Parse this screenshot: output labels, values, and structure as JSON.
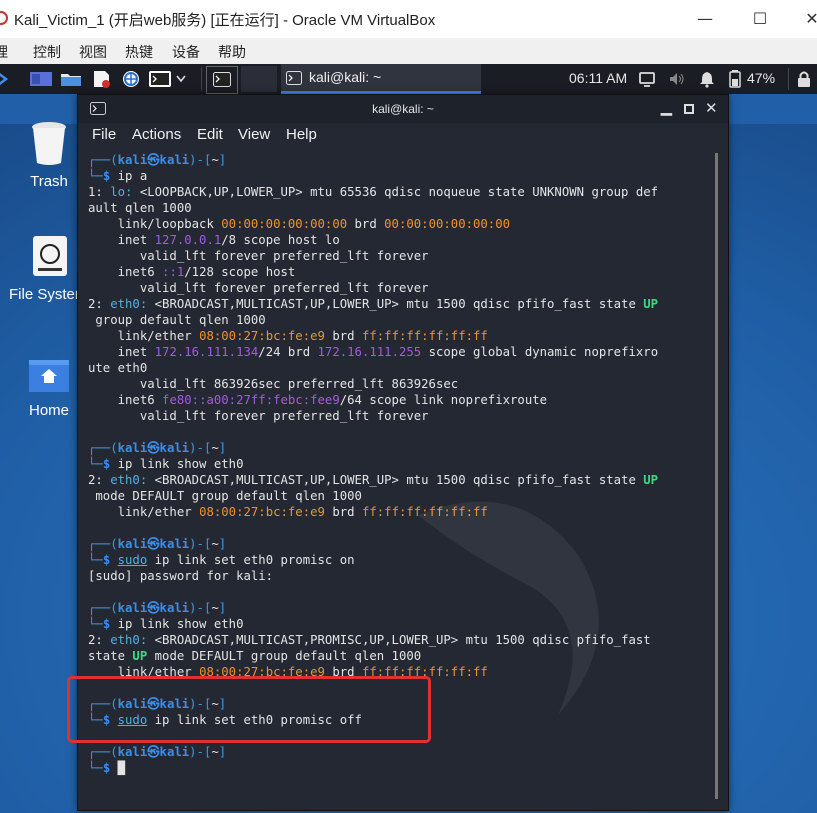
{
  "window": {
    "title": "Kali_Victim_1 (开启web服务) [正在运行] - Oracle VM VirtualBox"
  },
  "vbox_menu": [
    "理",
    "控制",
    "视图",
    "热键",
    "设备",
    "帮助"
  ],
  "panel": {
    "task_label": "kali@kali: ~",
    "time": "06:11 AM",
    "battery": "47%"
  },
  "desktop_icons": [
    {
      "label": "Trash",
      "icon": "trash-icon"
    },
    {
      "label": "File Syster",
      "icon": "drive-icon"
    },
    {
      "label": "Home",
      "icon": "home-folder-icon"
    }
  ],
  "terminal": {
    "title": "kali@kali: ~",
    "menu": [
      "File",
      "Actions",
      "Edit",
      "View",
      "Help"
    ],
    "lines": [
      [
        {
          "t": "┌──(",
          "c": "g"
        },
        {
          "t": "kali㉿kali",
          "c": "b"
        },
        {
          "t": ")-[",
          "c": "g"
        },
        {
          "t": "~",
          "c": "w"
        },
        {
          "t": "]",
          "c": "g"
        }
      ],
      [
        {
          "t": "└─",
          "c": "g"
        },
        {
          "t": "$ ",
          "c": "b"
        },
        {
          "t": "ip a",
          "c": "w"
        }
      ],
      [
        {
          "t": "1: ",
          "c": "w"
        },
        {
          "t": "lo:",
          "c": "u"
        },
        {
          "t": " <LOOPBACK,UP,LOWER_UP> mtu 65536 qdisc noqueue state UNKNOWN group def",
          "c": "w"
        }
      ],
      [
        {
          "t": "ault qlen 1000",
          "c": "w"
        }
      ],
      [
        {
          "t": "    link/loopback ",
          "c": "w"
        },
        {
          "t": "00:00:00:00:00:00",
          "c": "o"
        },
        {
          "t": " brd ",
          "c": "w"
        },
        {
          "t": "00:00:00:00:00:00",
          "c": "o"
        }
      ],
      [
        {
          "t": "    inet ",
          "c": "w"
        },
        {
          "t": "127.0.0.1",
          "c": "p"
        },
        {
          "t": "/8 scope host lo",
          "c": "w"
        }
      ],
      [
        {
          "t": "       valid_lft forever preferred_lft forever",
          "c": "w"
        }
      ],
      [
        {
          "t": "    inet6 ",
          "c": "w"
        },
        {
          "t": "::1",
          "c": "p"
        },
        {
          "t": "/128 scope host",
          "c": "w"
        }
      ],
      [
        {
          "t": "       valid_lft forever preferred_lft forever",
          "c": "w"
        }
      ],
      [
        {
          "t": "2: ",
          "c": "w"
        },
        {
          "t": "eth0:",
          "c": "u"
        },
        {
          "t": " <BROADCAST,MULTICAST,UP,LOWER_UP> mtu 1500 qdisc pfifo_fast state ",
          "c": "w"
        },
        {
          "t": "UP",
          "c": "up"
        }
      ],
      [
        {
          "t": " group default qlen 1000",
          "c": "w"
        }
      ],
      [
        {
          "t": "    link/ether ",
          "c": "w"
        },
        {
          "t": "08:00:27:bc:fe:e9",
          "c": "o"
        },
        {
          "t": " brd ",
          "c": "w"
        },
        {
          "t": "ff:ff:ff:ff:ff:ff",
          "c": "o"
        }
      ],
      [
        {
          "t": "    inet ",
          "c": "w"
        },
        {
          "t": "172.16.111.134",
          "c": "p"
        },
        {
          "t": "/24 brd ",
          "c": "w"
        },
        {
          "t": "172.16.111.255",
          "c": "p"
        },
        {
          "t": " scope global dynamic noprefixro",
          "c": "w"
        }
      ],
      [
        {
          "t": "ute eth0",
          "c": "w"
        }
      ],
      [
        {
          "t": "       valid_lft 863926sec preferred_lft 863926sec",
          "c": "w"
        }
      ],
      [
        {
          "t": "    inet6 ",
          "c": "w"
        },
        {
          "t": "fe80::a00:27ff:febc:fee9",
          "c": "p"
        },
        {
          "t": "/64 scope link noprefixroute",
          "c": "w"
        }
      ],
      [
        {
          "t": "       valid_lft forever preferred_lft forever",
          "c": "w"
        }
      ],
      [],
      [
        {
          "t": "┌──(",
          "c": "g"
        },
        {
          "t": "kali㉿kali",
          "c": "b"
        },
        {
          "t": ")-[",
          "c": "g"
        },
        {
          "t": "~",
          "c": "w"
        },
        {
          "t": "]",
          "c": "g"
        }
      ],
      [
        {
          "t": "└─",
          "c": "g"
        },
        {
          "t": "$ ",
          "c": "b"
        },
        {
          "t": "ip link show eth0",
          "c": "w"
        }
      ],
      [
        {
          "t": "2: ",
          "c": "w"
        },
        {
          "t": "eth0:",
          "c": "u"
        },
        {
          "t": " <BROADCAST,MULTICAST,UP,LOWER_UP> mtu 1500 qdisc pfifo_fast state ",
          "c": "w"
        },
        {
          "t": "UP",
          "c": "up"
        }
      ],
      [
        {
          "t": " mode DEFAULT group default qlen 1000",
          "c": "w"
        }
      ],
      [
        {
          "t": "    link/ether ",
          "c": "w"
        },
        {
          "t": "08:00:27:bc:fe:e9",
          "c": "o"
        },
        {
          "t": " brd ",
          "c": "w"
        },
        {
          "t": "ff:ff:ff:ff:ff:ff",
          "c": "o"
        }
      ],
      [],
      [
        {
          "t": "┌──(",
          "c": "g"
        },
        {
          "t": "kali㉿kali",
          "c": "b"
        },
        {
          "t": ")-[",
          "c": "g"
        },
        {
          "t": "~",
          "c": "w"
        },
        {
          "t": "]",
          "c": "g"
        }
      ],
      [
        {
          "t": "└─",
          "c": "g"
        },
        {
          "t": "$ ",
          "c": "b"
        },
        {
          "t": "sudo",
          "c": "sudo"
        },
        {
          "t": " ip link set eth0 promisc on",
          "c": "w"
        }
      ],
      [
        {
          "t": "[sudo] password for kali:",
          "c": "w"
        }
      ],
      [],
      [
        {
          "t": "┌──(",
          "c": "g"
        },
        {
          "t": "kali㉿kali",
          "c": "b"
        },
        {
          "t": ")-[",
          "c": "g"
        },
        {
          "t": "~",
          "c": "w"
        },
        {
          "t": "]",
          "c": "g"
        }
      ],
      [
        {
          "t": "└─",
          "c": "g"
        },
        {
          "t": "$ ",
          "c": "b"
        },
        {
          "t": "ip link show eth0",
          "c": "w"
        }
      ],
      [
        {
          "t": "2: ",
          "c": "w"
        },
        {
          "t": "eth0:",
          "c": "u"
        },
        {
          "t": " <BROADCAST,MULTICAST,PROMISC,UP,LOWER_UP> mtu 1500 qdisc pfifo_fast",
          "c": "w"
        }
      ],
      [
        {
          "t": "state ",
          "c": "w"
        },
        {
          "t": "UP",
          "c": "up"
        },
        {
          "t": " mode DEFAULT group default qlen 1000",
          "c": "w"
        }
      ],
      [
        {
          "t": "    link/ether ",
          "c": "w"
        },
        {
          "t": "08:00:27:bc:fe:e9",
          "c": "o"
        },
        {
          "t": " brd ",
          "c": "w"
        },
        {
          "t": "ff:ff:ff:ff:ff:ff",
          "c": "o"
        }
      ],
      [],
      [
        {
          "t": "┌──(",
          "c": "g"
        },
        {
          "t": "kali㉿kali",
          "c": "b"
        },
        {
          "t": ")-[",
          "c": "g"
        },
        {
          "t": "~",
          "c": "w"
        },
        {
          "t": "]",
          "c": "g"
        }
      ],
      [
        {
          "t": "└─",
          "c": "g"
        },
        {
          "t": "$ ",
          "c": "b"
        },
        {
          "t": "sudo",
          "c": "sudo"
        },
        {
          "t": " ip link set eth0 promisc off",
          "c": "w"
        }
      ],
      [],
      [
        {
          "t": "┌──(",
          "c": "g"
        },
        {
          "t": "kali㉿kali",
          "c": "b"
        },
        {
          "t": ")-[",
          "c": "g"
        },
        {
          "t": "~",
          "c": "w"
        },
        {
          "t": "]",
          "c": "g"
        }
      ],
      [
        {
          "t": "└─",
          "c": "g"
        },
        {
          "t": "$ ",
          "c": "b"
        },
        {
          "t": "█",
          "c": "w"
        }
      ]
    ]
  },
  "colors": {
    "highlight_box": "#e03030",
    "terminal_bg": "#232833",
    "prompt_user": "#3c8df0",
    "mac_addr": "#f0932b",
    "ip_addr": "#a65ae0",
    "state_up": "#3ddc84"
  }
}
